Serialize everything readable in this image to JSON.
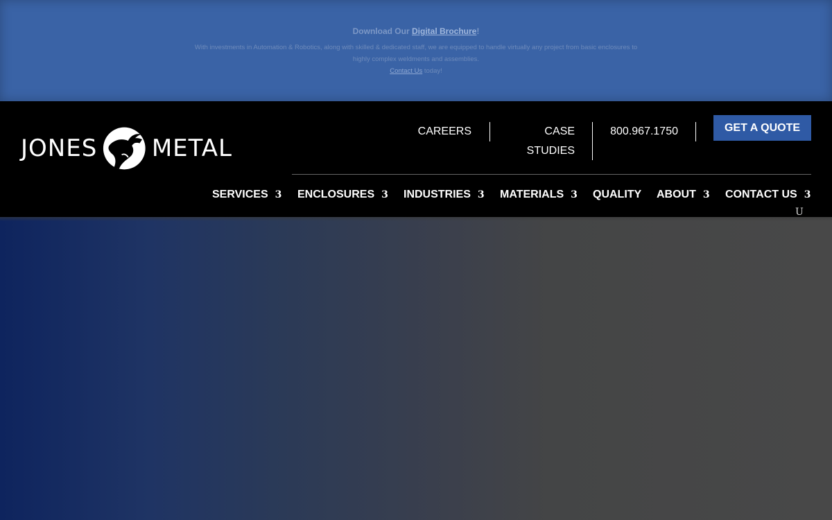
{
  "promo": {
    "title_prefix": "Download Our ",
    "title_link": "Digital Brochure",
    "title_suffix": "!",
    "body": "With investments in Automation & Robotics, along with skilled & dedicated staff, we are equipped to handle virtually any project from basic enclosures to highly complex weldments and assemblies.",
    "contact_link": "Contact Us",
    "contact_suffix": " today!"
  },
  "header": {
    "logo_left": "JONES",
    "logo_right": "METAL",
    "top_links": {
      "careers": "CAREERS",
      "case_studies_line1": "CASE",
      "case_studies_line2": "STUDIES",
      "phone": "800.967.1750"
    },
    "quote_button": "GET A QUOTE",
    "nav": {
      "services": "SERVICES",
      "enclosures": "ENCLOSURES",
      "industries": "INDUSTRIES",
      "materials": "MATERIALS",
      "quality": "QUALITY",
      "about": "ABOUT",
      "contact": "CONTACT US",
      "caret": "3"
    },
    "u_icon": "U"
  },
  "colors": {
    "promo_bg": "#3a63a6",
    "header_bg": "#000000",
    "quote_bg": "#2f5aa5",
    "hero_left": "#0e245e",
    "hero_right": "#484848"
  }
}
